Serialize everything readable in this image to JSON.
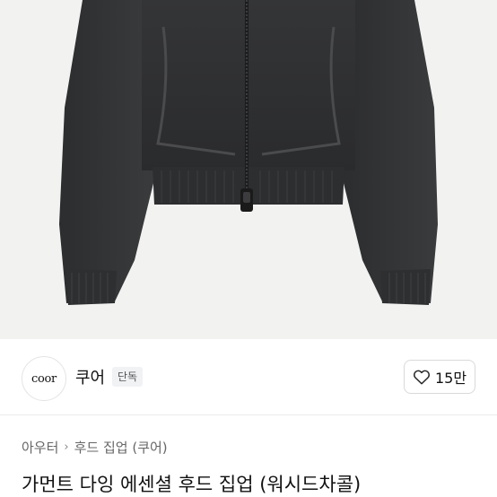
{
  "brand": {
    "logo_text": "coor",
    "name": "쿠어",
    "badge": "단독"
  },
  "like": {
    "icon": "heart-icon",
    "count": "15만"
  },
  "breadcrumb": {
    "items": [
      "아우터",
      "후드 집업 (쿠어)"
    ],
    "separator_icon": "chevron-right-icon"
  },
  "product": {
    "title": "가먼트 다잉 에센셜 후드 집업 (워시드차콜)",
    "image": "washed-charcoal-hoodie-photo"
  }
}
